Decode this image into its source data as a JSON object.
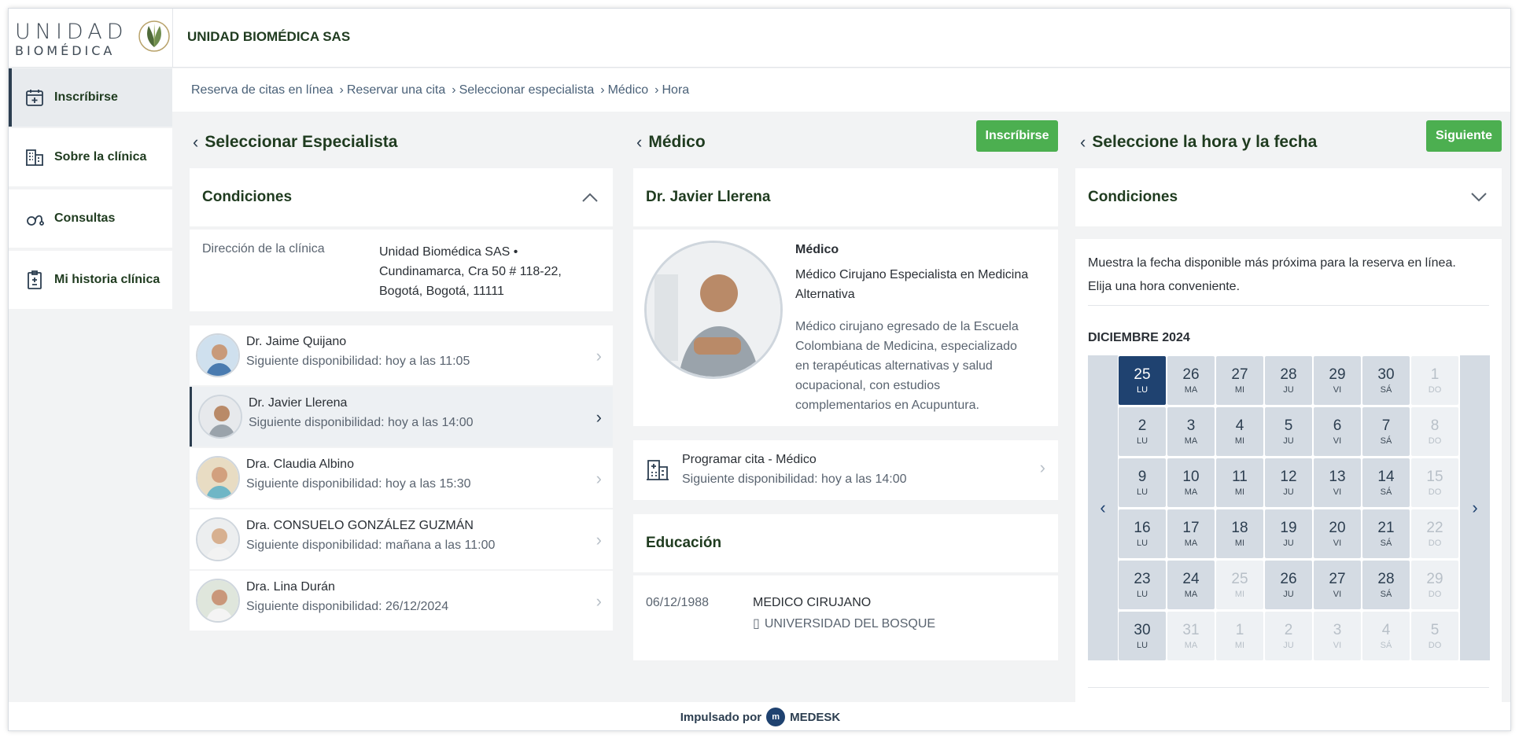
{
  "brand": {
    "logo_line1": "UNIDAD",
    "logo_line2": "BIOMÉDICA",
    "name": "UNIDAD BIOMÉDICA SAS"
  },
  "sidebar": {
    "items": [
      {
        "label": "Inscríbirse",
        "icon": "calendar-plus-icon"
      },
      {
        "label": "Sobre la clínica",
        "icon": "building-icon"
      },
      {
        "label": "Consultas",
        "icon": "stethoscope-icon"
      },
      {
        "label": "Mi historia clínica",
        "icon": "medical-record-icon"
      }
    ]
  },
  "breadcrumb": [
    "Reserva de citas en línea",
    "Reservar una cita",
    "Seleccionar especialista",
    "Médico",
    "Hora"
  ],
  "col1": {
    "title": "Seleccionar Especialista",
    "conditions_title": "Condiciones",
    "address_label": "Dirección de la clínica",
    "address_lines": [
      "Unidad Biomédica SAS •",
      "Cundinamarca, Cra 50 # 118-22,",
      "Bogotá, Bogotá, 11111"
    ],
    "doctors": [
      {
        "name": "Dr. Jaime Quijano",
        "availability": "Siguiente disponibilidad: hoy a las 11:05"
      },
      {
        "name": "Dr. Javier Llerena",
        "availability": "Siguiente disponibilidad: hoy a las 14:00"
      },
      {
        "name": "Dra. Claudia Albino",
        "availability": "Siguiente disponibilidad: hoy a las 15:30"
      },
      {
        "name": "Dra. CONSUELO GONZÁLEZ GUZMÁN",
        "availability": "Siguiente disponibilidad: mañana a las 11:00"
      },
      {
        "name": "Dra. Lina Durán",
        "availability": "Siguiente disponibilidad: 26/12/2024"
      }
    ]
  },
  "col2": {
    "title": "Médico",
    "enroll_label": "Inscríbirse",
    "doctor_name": "Dr. Javier Llerena",
    "role": "Médico",
    "specialty_lines": [
      "Médico Cirujano Especialista en Medicina",
      "Alternativa"
    ],
    "bio_lines": [
      "Médico cirujano egresado de la Escuela",
      "Colombiana de Medicina, especializado",
      "en terapéuticas alternativas y salud",
      "ocupacional, con estudios",
      "complementarios en Acupuntura."
    ],
    "appointment_title": "Programar cita - Médico",
    "appointment_availability": "Siguiente disponibilidad: hoy a las 14:00",
    "education_title": "Educación",
    "education_date": "06/12/1988",
    "education_degree": "MEDICO CIRUJANO",
    "education_school": "UNIVERSIDAD DEL BOSQUE"
  },
  "col3": {
    "title": "Seleccione la hora y la fecha",
    "next_label": "Siguiente",
    "conditions_title": "Condiciones",
    "info_line1": "Muestra la fecha disponible más próxima para la reserva en línea.",
    "info_line2": "Elija una hora conveniente.",
    "month": "DICIEMBRE 2024",
    "weeks": [
      [
        [
          "25",
          "LU",
          "sel"
        ],
        [
          "26",
          "MA",
          ""
        ],
        [
          "27",
          "MI",
          ""
        ],
        [
          "28",
          "JU",
          ""
        ],
        [
          "29",
          "VI",
          ""
        ],
        [
          "30",
          "SÁ",
          ""
        ],
        [
          "1",
          "DO",
          "off"
        ]
      ],
      [
        [
          "2",
          "LU",
          ""
        ],
        [
          "3",
          "MA",
          ""
        ],
        [
          "4",
          "MI",
          ""
        ],
        [
          "5",
          "JU",
          ""
        ],
        [
          "6",
          "VI",
          ""
        ],
        [
          "7",
          "SÁ",
          ""
        ],
        [
          "8",
          "DO",
          "off"
        ]
      ],
      [
        [
          "9",
          "LU",
          ""
        ],
        [
          "10",
          "MA",
          ""
        ],
        [
          "11",
          "MI",
          ""
        ],
        [
          "12",
          "JU",
          ""
        ],
        [
          "13",
          "VI",
          ""
        ],
        [
          "14",
          "SÁ",
          ""
        ],
        [
          "15",
          "DO",
          "off"
        ]
      ],
      [
        [
          "16",
          "LU",
          ""
        ],
        [
          "17",
          "MA",
          ""
        ],
        [
          "18",
          "MI",
          ""
        ],
        [
          "19",
          "JU",
          ""
        ],
        [
          "20",
          "VI",
          ""
        ],
        [
          "21",
          "SÁ",
          ""
        ],
        [
          "22",
          "DO",
          "off"
        ]
      ],
      [
        [
          "23",
          "LU",
          ""
        ],
        [
          "24",
          "MA",
          ""
        ],
        [
          "25",
          "MI",
          "off"
        ],
        [
          "26",
          "JU",
          ""
        ],
        [
          "27",
          "VI",
          ""
        ],
        [
          "28",
          "SÁ",
          ""
        ],
        [
          "29",
          "DO",
          "off"
        ]
      ],
      [
        [
          "30",
          "LU",
          ""
        ],
        [
          "31",
          "MA",
          "off"
        ],
        [
          "1",
          "MI",
          "off"
        ],
        [
          "2",
          "JU",
          "off"
        ],
        [
          "3",
          "VI",
          "off"
        ],
        [
          "4",
          "SÁ",
          "off"
        ],
        [
          "5",
          "DO",
          "off"
        ]
      ]
    ]
  },
  "footer": {
    "powered": "Impulsado por",
    "vendor": "MEDESK"
  }
}
